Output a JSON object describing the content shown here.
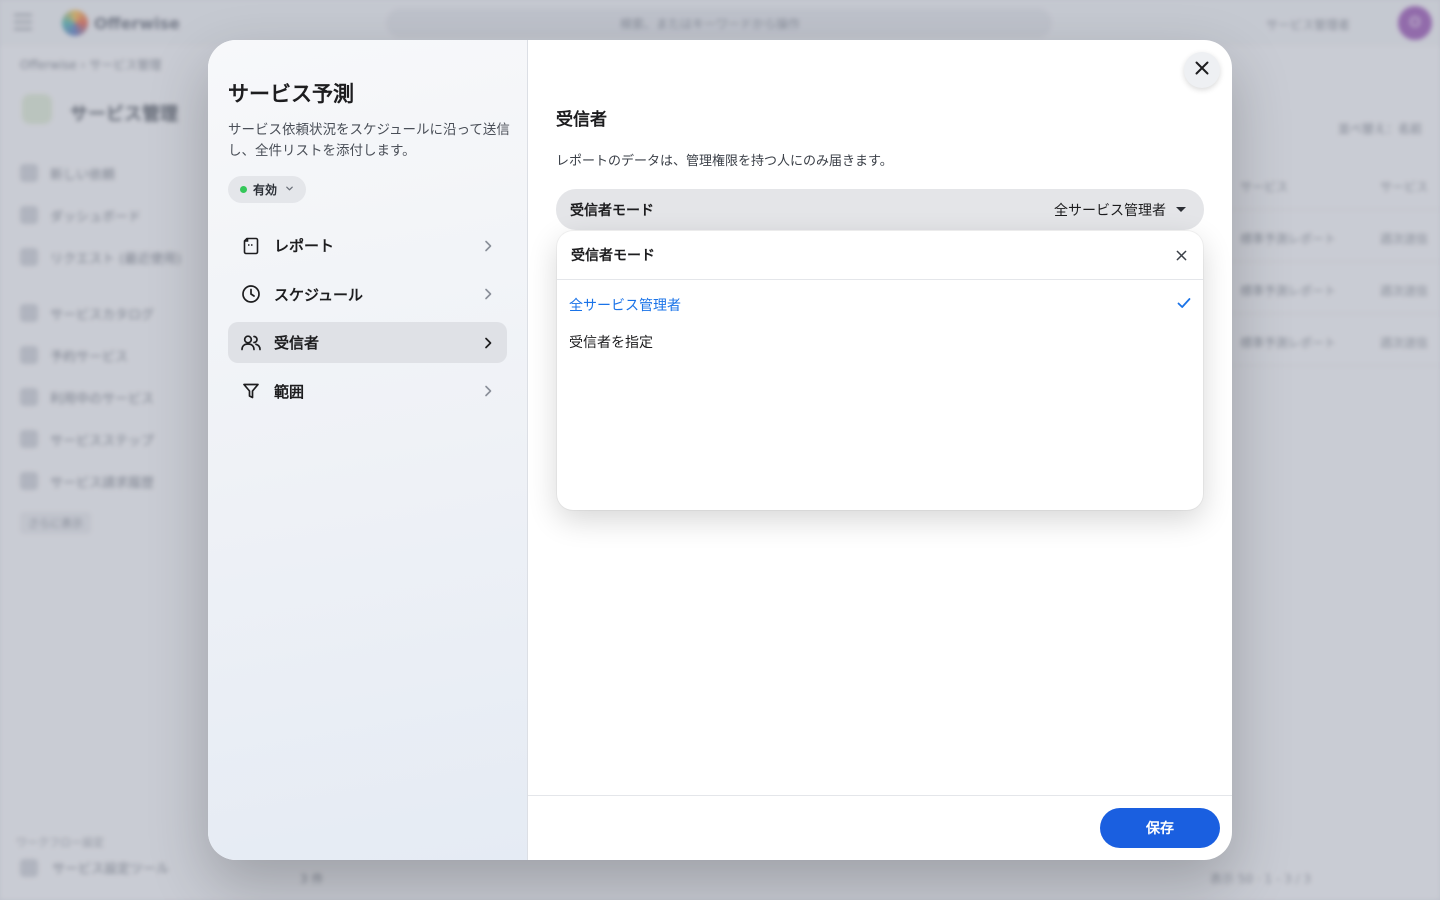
{
  "background": {
    "logo_text": "Offerwise",
    "search_text": "検索、またはキーワードから操作",
    "admin_label": "サービス管理者",
    "avatar_initial": "O",
    "breadcrumb": "Offerwise  ›  サービス管理",
    "page_title": "サービス管理",
    "sidebar_items": [
      "新しい依頼",
      "ダッシュボード",
      "リクエスト (最近使用)",
      "サービスカタログ",
      "予約サービス",
      "利用中のサービス",
      "サービスステップ",
      "サービス請求履歴"
    ],
    "sidebar_more": "さらに表示",
    "sidebar_section": "ワークフロー設定",
    "sidebar_bottom_item": "サービス設定ツール",
    "right_label": "並べ替え：名前",
    "table_rows": [
      {
        "name": "サービス",
        "col": "サービス"
      },
      {
        "name": "標準予測レポート",
        "col": "週次送信"
      },
      {
        "name": "標準予測レポート",
        "col": "週次送信"
      },
      {
        "name": "標準予測レポート",
        "col": "週次送信"
      }
    ],
    "footer_text": "3 件",
    "footer_right": "表示 50  ·  1 - 3 / 3"
  },
  "modal": {
    "title": "サービス予測",
    "description": "サービス依頼状況をスケジュールに沿って送信し、全件リストを添付します。",
    "status": {
      "label": "有効",
      "color": "#34c759"
    },
    "nav": [
      {
        "label": "レポート",
        "icon": "report-icon",
        "active": false
      },
      {
        "label": "スケジュール",
        "icon": "clock-icon",
        "active": false
      },
      {
        "label": "受信者",
        "icon": "people-icon",
        "active": true
      },
      {
        "label": "範囲",
        "icon": "filter-icon",
        "active": false
      }
    ],
    "section": {
      "title": "受信者",
      "description": "レポートのデータは、管理権限を持つ人にのみ届きます。"
    },
    "mode_select": {
      "label": "受信者モード",
      "value": "全サービス管理者"
    },
    "dropdown": {
      "title": "受信者モード",
      "options": [
        {
          "label": "全サービス管理者",
          "selected": true
        },
        {
          "label": "受信者を指定",
          "selected": false
        }
      ]
    },
    "save_label": "保存",
    "accent_color": "#1a5fe0"
  }
}
